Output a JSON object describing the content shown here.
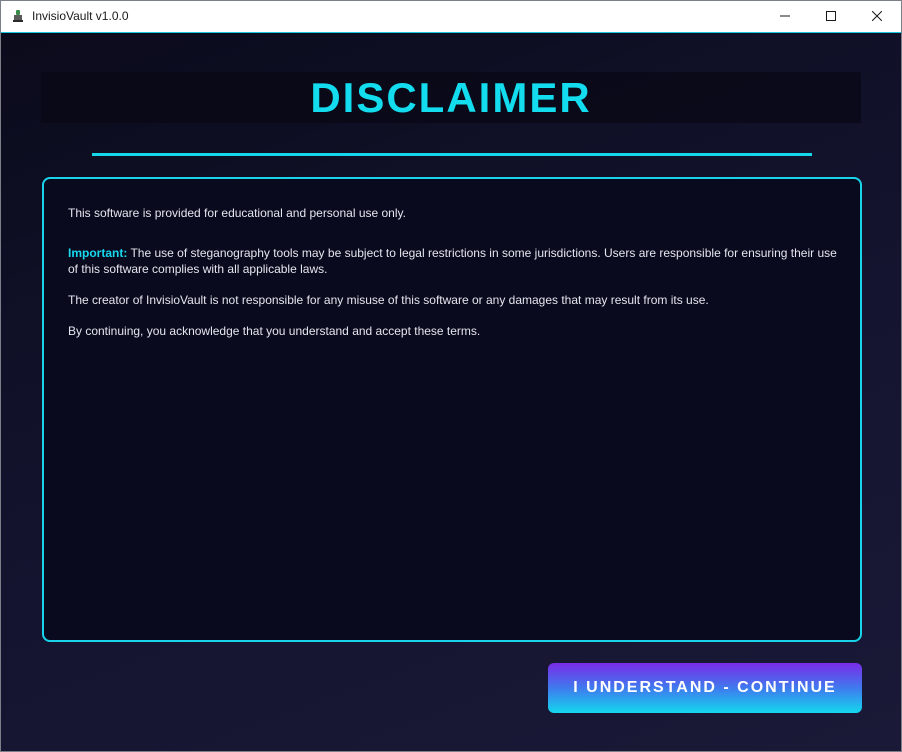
{
  "window": {
    "title": "InvisioVault v1.0.0",
    "icon": "app-icon",
    "controls": {
      "minimize_icon": "minimize-icon",
      "maximize_icon": "maximize-icon",
      "close_icon": "close-icon"
    }
  },
  "disclaimer": {
    "heading": "DISCLAIMER",
    "paragraph_1": "This software is provided for educational and personal use only.",
    "important_label": "Important:",
    "paragraph_2": " The use of steganography tools may be subject to legal restrictions in some jurisdictions. Users are responsible for ensuring their use of this software complies with all applicable laws.",
    "paragraph_3": "The creator of InvisioVault is not responsible for any misuse of this software or any damages that may result from its use.",
    "paragraph_4": "By continuing, you acknowledge that you understand and accept these terms."
  },
  "actions": {
    "continue_label": "I UNDERSTAND - CONTINUE"
  },
  "colors": {
    "accent": "#12dced",
    "background": "#0b0b1c",
    "button_gradient_top": "#7a2ce8",
    "button_gradient_bottom": "#14d8ee"
  }
}
